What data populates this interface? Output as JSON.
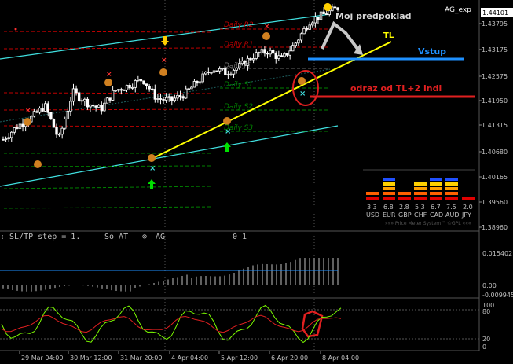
{
  "window": {
    "title": "AG_exp",
    "current_price": "1.44101"
  },
  "price_axis": [
    "1.43795",
    "1.43175",
    "1.42575",
    "1.41950",
    "1.41315",
    "1.40680",
    "1.40165",
    "1.39560",
    "1.38960"
  ],
  "time_axis": [
    "29 Mar 04:00",
    "30 Mar 12:00",
    "31 Mar 20:00",
    "4 Apr 04:00",
    "5 Apr 12:00",
    "6 Apr 20:00",
    "8 Apr 04:00"
  ],
  "pivot_labels": [
    "Daily R2",
    "Daily R1",
    "Daily Pi",
    "Daily S1",
    "Daily S2",
    "Daily S3"
  ],
  "annotations": {
    "assumption": "Moj predpoklad",
    "trendline": "TL",
    "entry": "Vstup",
    "bounce": "odraz od TL+2 indi"
  },
  "price_meter": {
    "values": [
      "3.3",
      "6.8",
      "2.8",
      "5.3",
      "6.7",
      "7.5",
      "2.0"
    ],
    "currencies": [
      "USD",
      "EUR",
      "GBP",
      "CHF",
      "CAD",
      "AUD",
      "JPY"
    ],
    "footer": "»»» Price Meter System™ ©GPL «««"
  },
  "status_bar": {
    "text": ": SL/TP step = 1.",
    "mode": "So AT",
    "symbol": "AG",
    "right": "0 1"
  },
  "oscillator1": {
    "labels": [
      "0.015402",
      "0.00",
      "-0.009945"
    ]
  },
  "oscillator2": {
    "labels": [
      "100",
      "80",
      "20",
      "0"
    ]
  },
  "colors": {
    "candle": "#ffffff",
    "bands": "#40e0e0",
    "trendline": "#ffff00",
    "entry_line": "#1e90ff",
    "bounce_line": "#e02020",
    "rsi_fast": "#7cfc00",
    "rsi_slow": "#e02020"
  },
  "chart_data": {
    "type": "candlestick",
    "categories": [
      "29 Mar 04:00",
      "30 Mar 12:00",
      "31 Mar 20:00",
      "4 Apr 04:00",
      "5 Apr 12:00",
      "6 Apr 20:00",
      "8 Apr 04:00"
    ],
    "close": [
      1.4105,
      1.4135,
      1.4155,
      1.4183,
      1.4105,
      1.4215,
      1.419,
      1.4175,
      1.4218,
      1.423,
      1.4245,
      1.42,
      1.4195,
      1.421,
      1.424,
      1.427,
      1.426,
      1.4275,
      1.43,
      1.431,
      1.429,
      1.433,
      1.438,
      1.4395,
      1.441
    ],
    "ylim": [
      1.3896,
      1.441
    ]
  }
}
